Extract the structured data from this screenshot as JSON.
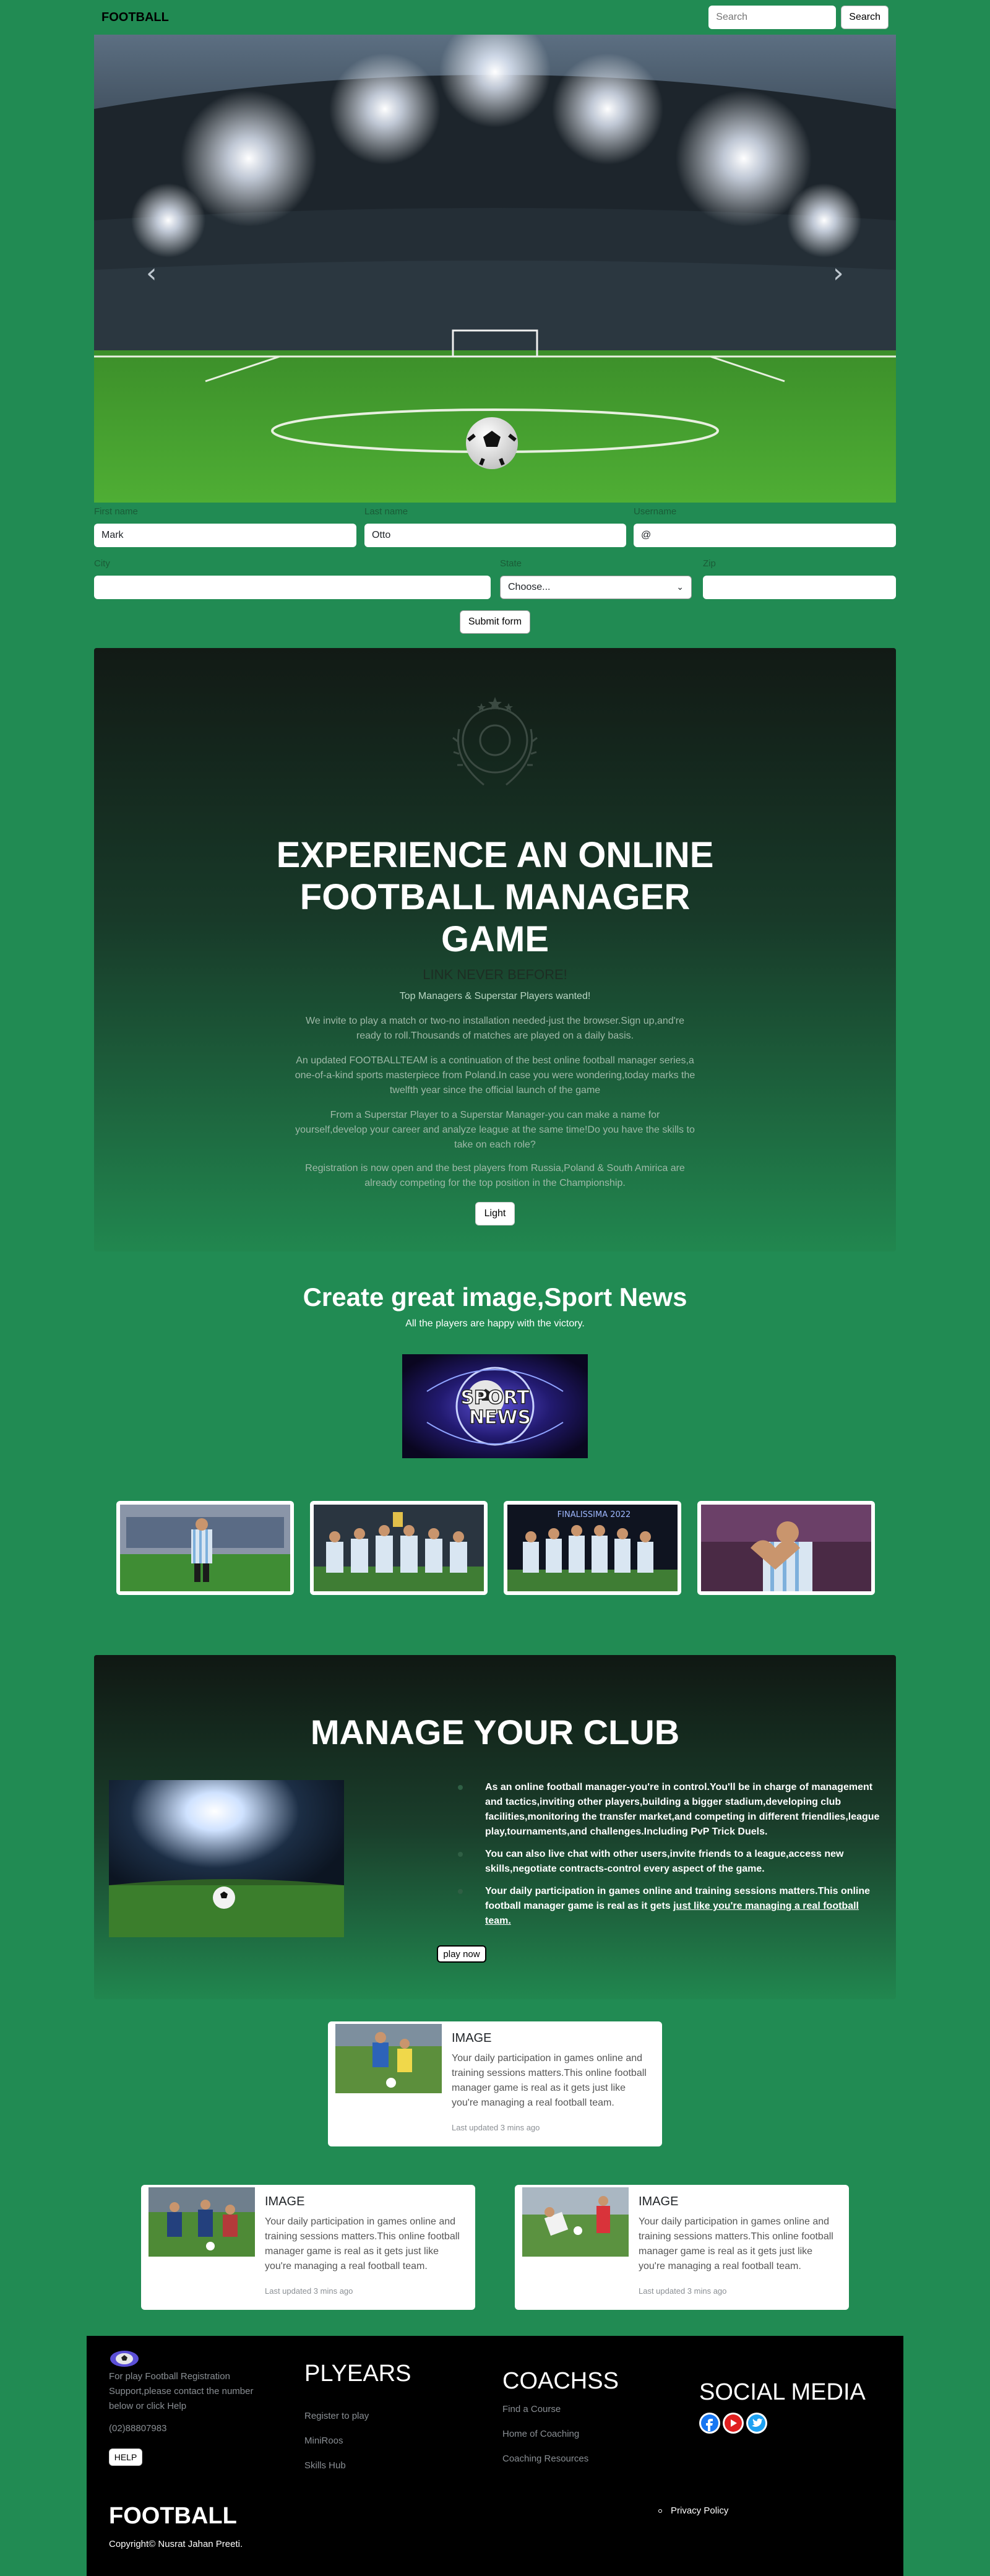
{
  "nav": {
    "brand": "FOOTBALL",
    "search_placeholder": "Search",
    "search_label": "Search"
  },
  "carousel": {
    "prev_icon": "‹",
    "next_icon": "›"
  },
  "form": {
    "first_name": {
      "label": "First name",
      "value": "Mark"
    },
    "last_name": {
      "label": "Last name",
      "value": "Otto"
    },
    "username": {
      "label": "Username",
      "prefix": "@",
      "value": ""
    },
    "city": {
      "label": "City",
      "value": ""
    },
    "state": {
      "label": "State",
      "value": "Choose..."
    },
    "zip": {
      "label": "Zip",
      "value": ""
    },
    "submit_label": "Submit form"
  },
  "experience": {
    "title": "EXPERIENCE AN ONLINE FOOTBALL MANAGER GAME",
    "subtitle": "LINK NEVER BEFORE!",
    "tagline": "Top Managers & Superstar Players wanted!",
    "p1": "We invite to play a match or two-no installation needed-just the browser.Sign up,and're ready to roll.Thousands of matches are played on a daily basis.",
    "p2": "An updated FOOTBALLTEAM is a continuation of the best online football manager series,a one-of-a-kind sports masterpiece from Poland.In case you were wondering,today marks the twelfth year since the official launch of the game",
    "p3": "From a Superstar Player to a Superstar Manager-you can make a name for yourself,develop your career and analyze league at the same time!Do you have the skills to take on each role?",
    "p4": "Registration is now open and the best players from Russia,Poland & South Amirica are already competing for the top position in the Championship.",
    "button": "Light"
  },
  "news": {
    "title": "Create great image,Sport News",
    "subtitle": "All the players are happy with the victory.",
    "logo_text": "SPORT NEWS",
    "trophy_banner": "FINALISSIMA 2022"
  },
  "manage": {
    "title": "MANAGE YOUR CLUB",
    "b1": "As an online football manager-you're in control.You'll be in charge of management and tactics,inviting other players,building a bigger stadium,developing club facilities,monitoring the transfer market,and competing in different friendlies,league play,tournaments,and challenges.Including PvP Trick Duels.",
    "b2": "You can also live chat with other users,invite friends to a league,access new skills,negotiate contracts-control every aspect of the game.",
    "b3_a": "Your daily participation in games online and training sessions matters.This online football manager game is real as it gets ",
    "b3_b": "just like you're managing a real football team.",
    "button": "play now"
  },
  "cards": [
    {
      "title": "IMAGE",
      "text": "Your daily participation in games online and training sessions matters.This online football manager game is real as it gets just like you're managing a real football team.",
      "meta": "Last updated 3 mins ago"
    },
    {
      "title": "IMAGE",
      "text": "Your daily participation in games online and training sessions matters.This online football manager game is real as it gets just like you're managing a real football team.",
      "meta": "Last updated 3 mins ago"
    },
    {
      "title": "IMAGE",
      "text": "Your daily participation in games online and training sessions matters.This online football manager game is real as it gets just like you're managing a real football team.",
      "meta": "Last updated 3 mins ago"
    }
  ],
  "footer": {
    "support_text": "For play Football Registration Support,please contact the number below or click Help",
    "phone": "(02)88807983",
    "help_label": "HELP",
    "players_heading": "PLYEARS",
    "players_links": [
      "Register to play",
      "MiniRoos",
      "Skills Hub"
    ],
    "coach_heading": "COACHSS",
    "coach_links": [
      "Find a Course",
      "Home of Coaching",
      "Coaching Resources"
    ],
    "social_heading": "SOCIAL MEDIA",
    "social": [
      "facebook-icon",
      "youtube-icon",
      "twitter-icon"
    ],
    "brand": "FOOTBALL",
    "copyright": "Copyright© Nusrat Jahan Preeti.",
    "privacy": "Privacy Policy"
  },
  "colors": {
    "page_bg": "#218b53",
    "footer_bg": "#000000"
  }
}
